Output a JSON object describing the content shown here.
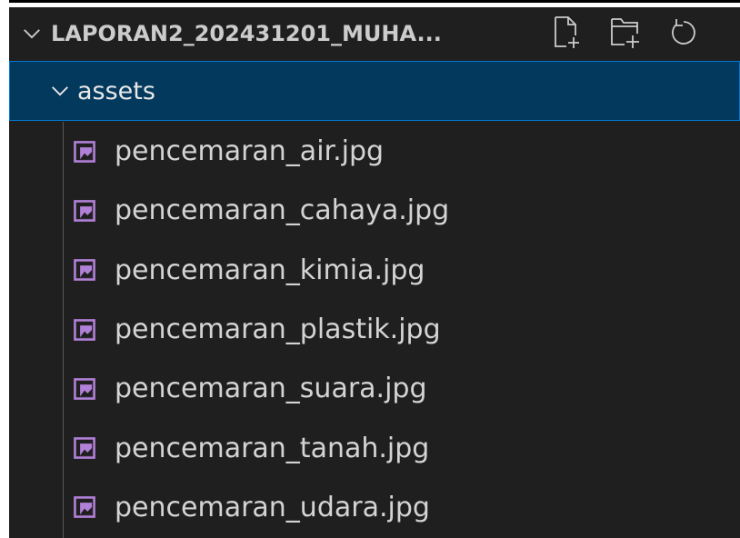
{
  "explorer": {
    "title": "LAPORAN2_202431201_MUHA...",
    "actions": [
      {
        "name": "new-file-icon"
      },
      {
        "name": "new-folder-icon"
      },
      {
        "name": "refresh-icon"
      }
    ],
    "folder": {
      "label": "assets",
      "expanded": true
    },
    "files": [
      {
        "label": "pencemaran_air.jpg",
        "icon": "image-file-icon"
      },
      {
        "label": "pencemaran_cahaya.jpg",
        "icon": "image-file-icon"
      },
      {
        "label": "pencemaran_kimia.jpg",
        "icon": "image-file-icon"
      },
      {
        "label": "pencemaran_plastik.jpg",
        "icon": "image-file-icon"
      },
      {
        "label": "pencemaran_suara.jpg",
        "icon": "image-file-icon"
      },
      {
        "label": "pencemaran_tanah.jpg",
        "icon": "image-file-icon"
      },
      {
        "label": "pencemaran_udara.jpg",
        "icon": "image-file-icon"
      }
    ],
    "colors": {
      "background": "#1f1f1f",
      "selection": "#04395e",
      "focus_border": "#0078d4",
      "image_icon": "#b180d7"
    }
  }
}
